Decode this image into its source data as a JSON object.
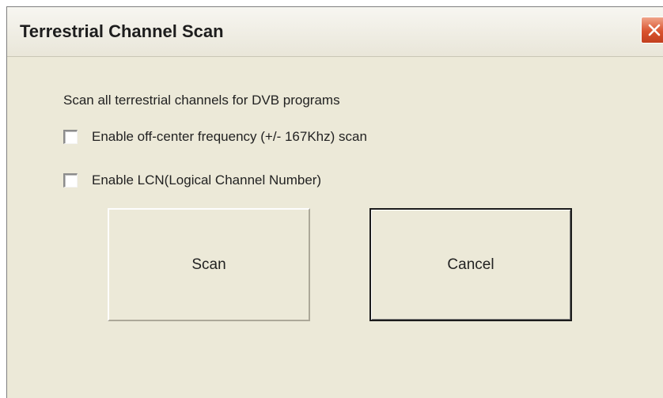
{
  "window": {
    "title": "Terrestrial Channel Scan",
    "close_icon": "close-icon"
  },
  "main": {
    "description": "Scan all terrestrial channels for DVB programs",
    "options": [
      {
        "label": "Enable off-center frequency (+/- 167Khz) scan",
        "checked": false
      },
      {
        "label": "Enable LCN(Logical Channel Number)",
        "checked": false
      }
    ],
    "buttons": {
      "scan": "Scan",
      "cancel": "Cancel"
    }
  },
  "colors": {
    "dialog_background": "#ece9d8",
    "close_button": "#d9532f"
  }
}
